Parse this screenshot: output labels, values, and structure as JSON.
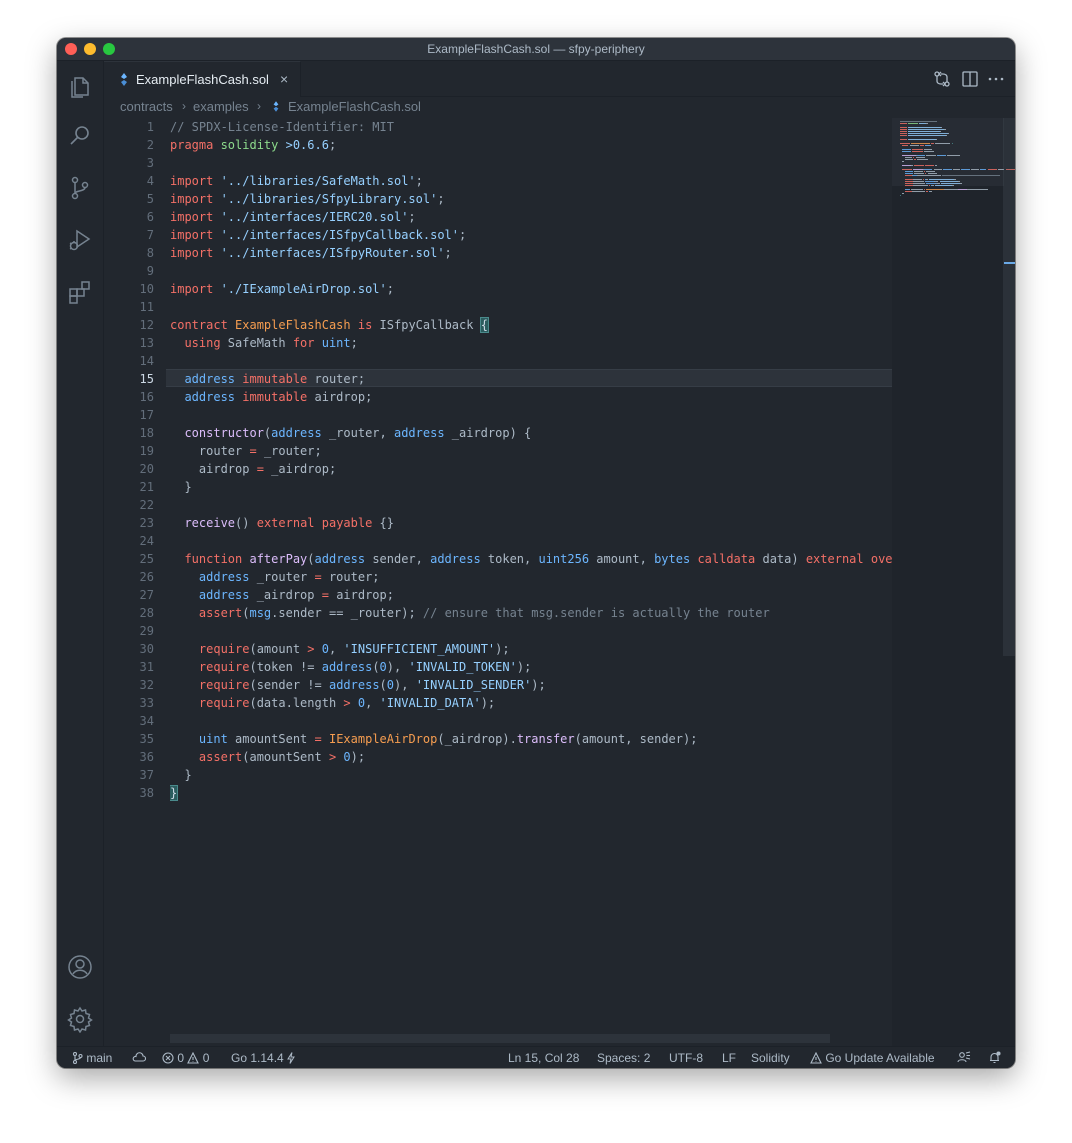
{
  "window": {
    "title": "ExampleFlashCash.sol — sfpy-periphery"
  },
  "activity_bar": {
    "items": [
      "explorer-icon",
      "search-icon",
      "source-control-icon",
      "run-debug-icon",
      "extensions-icon"
    ],
    "bottom": [
      "accounts-icon",
      "settings-gear-icon"
    ]
  },
  "tab": {
    "label": "ExampleFlashCash.sol",
    "close": "×",
    "icon": "solidity-file-icon"
  },
  "tab_actions": [
    "compare-changes-icon",
    "split-editor-icon",
    "more-actions-icon"
  ],
  "breadcrumb": {
    "items": [
      "contracts",
      "examples",
      "ExampleFlashCash.sol"
    ]
  },
  "editor": {
    "current_line": 15,
    "lines": [
      [
        [
          "// SPDX-License-Identifier: MIT",
          "cm"
        ]
      ],
      [
        [
          "pragma ",
          "kw"
        ],
        [
          "solidity ",
          "pr"
        ],
        [
          ">0.6.6",
          "st"
        ],
        [
          ";",
          ""
        ]
      ],
      [],
      [
        [
          "import ",
          "kw"
        ],
        [
          "'../libraries/SafeMath.sol'",
          "st"
        ],
        [
          ";",
          ""
        ]
      ],
      [
        [
          "import ",
          "kw"
        ],
        [
          "'../libraries/SfpyLibrary.sol'",
          "st"
        ],
        [
          ";",
          ""
        ]
      ],
      [
        [
          "import ",
          "kw"
        ],
        [
          "'../interfaces/IERC20.sol'",
          "st"
        ],
        [
          ";",
          ""
        ]
      ],
      [
        [
          "import ",
          "kw"
        ],
        [
          "'../interfaces/ISfpyCallback.sol'",
          "st"
        ],
        [
          ";",
          ""
        ]
      ],
      [
        [
          "import ",
          "kw"
        ],
        [
          "'../interfaces/ISfpyRouter.sol'",
          "st"
        ],
        [
          ";",
          ""
        ]
      ],
      [],
      [
        [
          "import ",
          "kw"
        ],
        [
          "'./IExampleAirDrop.sol'",
          "st"
        ],
        [
          ";",
          ""
        ]
      ],
      [],
      [
        [
          "contract ",
          "kw"
        ],
        [
          "ExampleFlashCash ",
          "ti"
        ],
        [
          "is ",
          "kw"
        ],
        [
          "ISfpyCallback ",
          ""
        ],
        [
          "{",
          "bm"
        ]
      ],
      [
        [
          "  using ",
          "kw"
        ],
        [
          "SafeMath ",
          ""
        ],
        [
          "for ",
          "kw"
        ],
        [
          "uint",
          "ty"
        ],
        [
          ";",
          ""
        ]
      ],
      [],
      [
        [
          "  address ",
          "ty"
        ],
        [
          "immutable ",
          "kw"
        ],
        [
          "router;",
          ""
        ]
      ],
      [
        [
          "  address ",
          "ty"
        ],
        [
          "immutable ",
          "kw"
        ],
        [
          "airdrop;",
          ""
        ]
      ],
      [],
      [
        [
          "  constructor",
          "fn"
        ],
        [
          "(",
          ""
        ],
        [
          "address ",
          "ty"
        ],
        [
          "_router, ",
          ""
        ],
        [
          "address ",
          "ty"
        ],
        [
          "_airdrop) {",
          ""
        ]
      ],
      [
        [
          "    router ",
          ""
        ],
        [
          "= ",
          "kw"
        ],
        [
          "_router;",
          ""
        ]
      ],
      [
        [
          "    airdrop ",
          ""
        ],
        [
          "= ",
          "kw"
        ],
        [
          "_airdrop;",
          ""
        ]
      ],
      [
        [
          "  }",
          ""
        ]
      ],
      [],
      [
        [
          "  receive",
          "fn"
        ],
        [
          "() ",
          ""
        ],
        [
          "external ",
          "kw"
        ],
        [
          "payable ",
          "kw"
        ],
        [
          "{}",
          ""
        ]
      ],
      [],
      [
        [
          "  function ",
          "kw"
        ],
        [
          "afterPay",
          "fn"
        ],
        [
          "(",
          ""
        ],
        [
          "address ",
          "ty"
        ],
        [
          "sender, ",
          ""
        ],
        [
          "address ",
          "ty"
        ],
        [
          "token, ",
          ""
        ],
        [
          "uint256 ",
          "ty"
        ],
        [
          "amount, ",
          ""
        ],
        [
          "bytes ",
          "ty"
        ],
        [
          "calldata ",
          "kw"
        ],
        [
          "data) ",
          ""
        ],
        [
          "external ",
          "kw"
        ],
        [
          "override {",
          "kw"
        ]
      ],
      [
        [
          "    address ",
          "ty"
        ],
        [
          "_router ",
          ""
        ],
        [
          "= ",
          "kw"
        ],
        [
          "router;",
          ""
        ]
      ],
      [
        [
          "    address ",
          "ty"
        ],
        [
          "_airdrop ",
          ""
        ],
        [
          "= ",
          "kw"
        ],
        [
          "airdrop;",
          ""
        ]
      ],
      [
        [
          "    assert",
          "kw"
        ],
        [
          "(",
          ""
        ],
        [
          "msg",
          "ty"
        ],
        [
          ".sender == _router); ",
          ""
        ],
        [
          "// ensure that msg.sender is actually the router",
          "cm"
        ]
      ],
      [],
      [
        [
          "    require",
          "kw"
        ],
        [
          "(amount ",
          ""
        ],
        [
          "> ",
          "kw"
        ],
        [
          "0",
          "nu"
        ],
        [
          ", ",
          ""
        ],
        [
          "'INSUFFICIENT_AMOUNT'",
          "st"
        ],
        [
          ");",
          ""
        ]
      ],
      [
        [
          "    require",
          "kw"
        ],
        [
          "(token != ",
          ""
        ],
        [
          "address",
          "ty"
        ],
        [
          "(",
          ""
        ],
        [
          "0",
          "nu"
        ],
        [
          "), ",
          ""
        ],
        [
          "'INVALID_TOKEN'",
          "st"
        ],
        [
          ");",
          ""
        ]
      ],
      [
        [
          "    require",
          "kw"
        ],
        [
          "(sender != ",
          ""
        ],
        [
          "address",
          "ty"
        ],
        [
          "(",
          ""
        ],
        [
          "0",
          "nu"
        ],
        [
          "), ",
          ""
        ],
        [
          "'INVALID_SENDER'",
          "st"
        ],
        [
          ");",
          ""
        ]
      ],
      [
        [
          "    require",
          "kw"
        ],
        [
          "(data.length ",
          ""
        ],
        [
          "> ",
          "kw"
        ],
        [
          "0",
          "nu"
        ],
        [
          ", ",
          ""
        ],
        [
          "'INVALID_DATA'",
          "st"
        ],
        [
          ");",
          ""
        ]
      ],
      [],
      [
        [
          "    uint ",
          "ty"
        ],
        [
          "amountSent ",
          ""
        ],
        [
          "= ",
          "kw"
        ],
        [
          "IExampleAirDrop",
          "ti"
        ],
        [
          "(_airdrop).",
          ""
        ],
        [
          "transfer",
          "fn"
        ],
        [
          "(amount, sender);",
          ""
        ]
      ],
      [
        [
          "    assert",
          "kw"
        ],
        [
          "(amountSent ",
          ""
        ],
        [
          "> ",
          "kw"
        ],
        [
          "0",
          "nu"
        ],
        [
          ");",
          ""
        ]
      ],
      [
        [
          "  }",
          ""
        ]
      ],
      [
        [
          "}",
          "bm"
        ]
      ]
    ]
  },
  "status_bar": {
    "branch": "main",
    "errors": "0",
    "warnings": "0",
    "go_version": "Go 1.14.4",
    "position": "Ln 15, Col 28",
    "spaces": "Spaces: 2",
    "encoding": "UTF-8",
    "eol": "LF",
    "language": "Solidity",
    "update": "Go Update Available"
  }
}
